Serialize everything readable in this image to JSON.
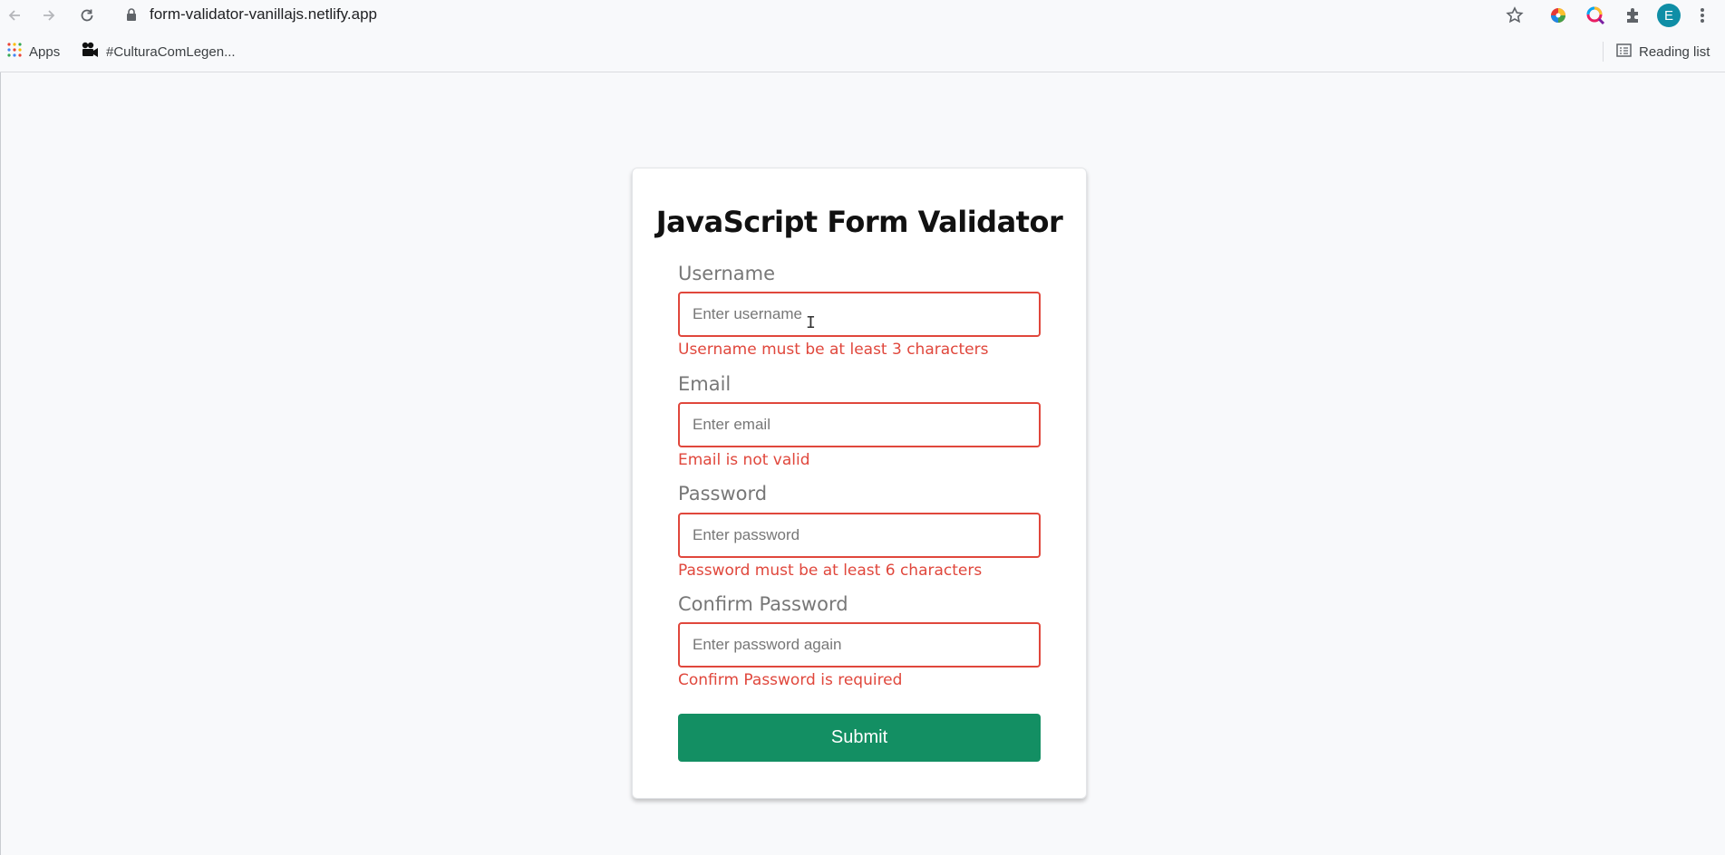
{
  "browser": {
    "url": "form-validator-vanillajs.netlify.app",
    "profile_initial": "E",
    "bookmarks": [
      {
        "label": "Apps",
        "icon": "apps-grid-icon"
      },
      {
        "label": "#CulturaComLegen...",
        "icon": "camera-icon"
      }
    ],
    "reading_list_label": "Reading list"
  },
  "form": {
    "title": "JavaScript Form Validator",
    "fields": [
      {
        "label": "Username",
        "placeholder": "Enter username",
        "error": "Username must be at least 3 characters"
      },
      {
        "label": "Email",
        "placeholder": "Enter email",
        "error": "Email is not valid"
      },
      {
        "label": "Password",
        "placeholder": "Enter password",
        "error": "Password must be at least 6 characters"
      },
      {
        "label": "Confirm Password",
        "placeholder": "Enter password again",
        "error": "Confirm Password is required"
      }
    ],
    "submit_label": "Submit"
  },
  "colors": {
    "error": "#e0473c",
    "submit": "#138f63",
    "background": "#f8f9fb"
  }
}
